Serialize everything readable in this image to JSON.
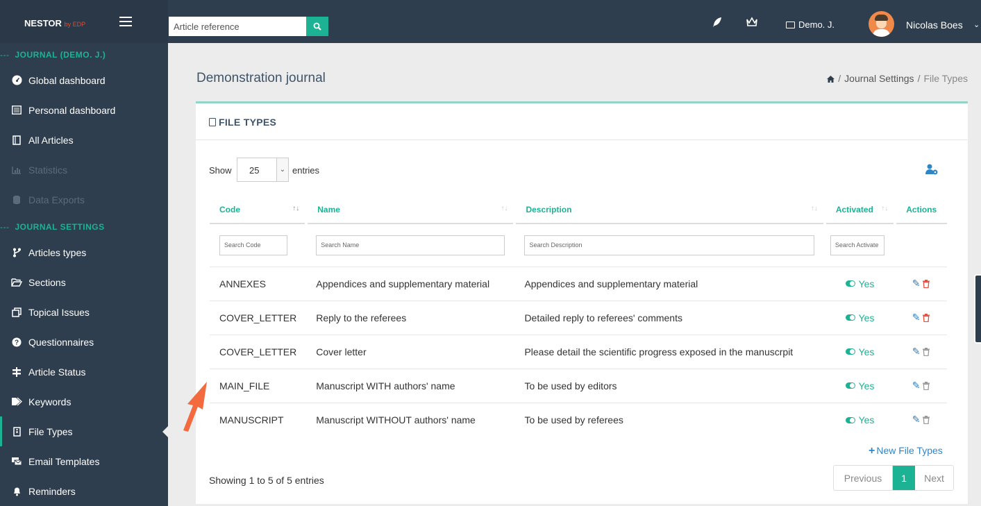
{
  "brand": {
    "name": "NESTOR",
    "by": "by EDP"
  },
  "search": {
    "placeholder": "Article reference"
  },
  "topbar": {
    "journal": "Demo. J.",
    "user": "Nicolas Boes"
  },
  "sidebar": {
    "section1": "JOURNAL (DEMO. J.)",
    "section2": "JOURNAL SETTINGS",
    "items": [
      {
        "label": "Global dashboard"
      },
      {
        "label": "Personal dashboard"
      },
      {
        "label": "All Articles"
      },
      {
        "label": "Statistics"
      },
      {
        "label": "Data Exports"
      },
      {
        "label": "Articles types"
      },
      {
        "label": "Sections"
      },
      {
        "label": "Topical Issues"
      },
      {
        "label": "Questionnaires"
      },
      {
        "label": "Article Status"
      },
      {
        "label": "Keywords"
      },
      {
        "label": "File Types"
      },
      {
        "label": "Email Templates"
      },
      {
        "label": "Reminders"
      }
    ]
  },
  "page": {
    "title": "Demonstration journal",
    "breadcrumb": {
      "part1": "Journal Settings",
      "part2": "File Types",
      "sep": "/"
    }
  },
  "panel": {
    "title": "FILE TYPES",
    "show_label": "Show",
    "show_value": "25",
    "entries_label": "entries",
    "columns": {
      "code": "Code",
      "name": "Name",
      "description": "Description",
      "activated": "Activated",
      "actions": "Actions"
    },
    "filters": {
      "code": "Search Code",
      "name": "Search Name",
      "description": "Search Description",
      "activated": "Search Activate"
    },
    "rows": [
      {
        "code": "ANNEXES",
        "name": "Appendices and supplementary material",
        "description": "Appendices and supplementary material",
        "activated": "Yes",
        "deletable": true
      },
      {
        "code": "COVER_LETTER",
        "name": "Reply to the referees",
        "description": "Detailed reply to referees' comments",
        "activated": "Yes",
        "deletable": true
      },
      {
        "code": "COVER_LETTER",
        "name": "Cover letter",
        "description": "Please detail the scientific progress exposed in the manuscrpit",
        "activated": "Yes",
        "deletable": false
      },
      {
        "code": "MAIN_FILE",
        "name": "Manuscript WITH authors' name",
        "description": "To be used by editors",
        "activated": "Yes",
        "deletable": false
      },
      {
        "code": "MANUSCRIPT",
        "name": "Manuscript WITHOUT authors' name",
        "description": "To be used by referees",
        "activated": "Yes",
        "deletable": false
      }
    ],
    "new_label": "New File Types",
    "showing": "Showing 1 to 5 of 5 entries",
    "pager": {
      "prev": "Previous",
      "page": "1",
      "next": "Next"
    }
  },
  "colors": {
    "accent": "#1bb394",
    "sidebar": "#2f3e4e",
    "link": "#2f86c6",
    "danger": "#e74c3c",
    "annotation_arrow": "#f26a3d"
  }
}
